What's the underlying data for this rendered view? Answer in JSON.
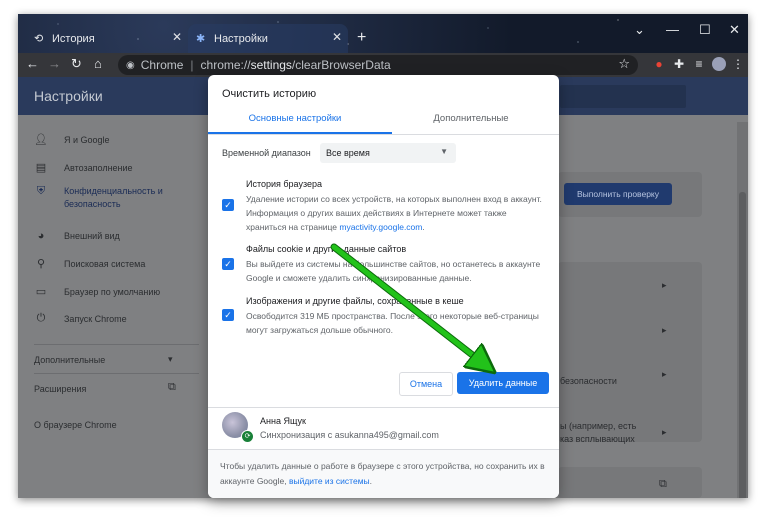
{
  "browser": {
    "tabs": [
      {
        "label": "История"
      },
      {
        "label": "Настройки"
      }
    ],
    "address": {
      "site": "Chrome",
      "url_scheme": "chrome://",
      "url_path": "settings",
      "url_rest": "/clearBrowserData"
    }
  },
  "settings": {
    "title": "Настройки",
    "sidebar": [
      {
        "label": "Я и Google"
      },
      {
        "label": "Автозаполнение"
      },
      {
        "label": "Конфиденциальность и безопасность"
      },
      {
        "label": "Внешний вид"
      },
      {
        "label": "Поисковая система"
      },
      {
        "label": "Браузер по умолчанию"
      },
      {
        "label": "Запуск Chrome"
      }
    ],
    "advanced": "Дополнительные",
    "extensions": "Расширения",
    "about": "О браузере Chrome",
    "check_button": "Выполнить проверку",
    "row_text_1": "безопасности",
    "row_text_2a": "ы (например, есть",
    "row_text_2b": "каз всплывающих"
  },
  "dialog": {
    "title": "Очистить историю",
    "tabs": {
      "basic": "Основные настройки",
      "advanced": "Дополнительные"
    },
    "time_range_label": "Временной диапазон",
    "time_range_value": "Все время",
    "items": [
      {
        "title": "История браузера",
        "desc": "Удаление истории со всех устройств, на которых выполнен вход в аккаунт. Информация о других ваших действиях в Интернете может также храниться на странице ",
        "link": "myactivity.google.com",
        "desc_end": ".",
        "checked": true
      },
      {
        "title": "Файлы cookie и другие данные сайтов",
        "desc": "Вы выйдете из системы на большинстве сайтов, но останетесь в аккаунте Google и сможете удалить синхронизированные данные.",
        "checked": true
      },
      {
        "title": "Изображения и другие файлы, сохраненные в кеше",
        "desc": "Освободится 319 МБ пространства. После этого некоторые веб-страницы могут загружаться дольше обычного.",
        "checked": true
      }
    ],
    "cancel_label": "Отмена",
    "delete_label": "Удалить данные",
    "account": {
      "name": "Анна Ящук",
      "sync": "Синхронизация с asukanna495@gmail.com"
    },
    "footer_text": "Чтобы удалить данные о работе в браузере с этого устройства, но сохранить их в аккаунте Google, ",
    "footer_link": "выйдите из системы",
    "footer_end": "."
  },
  "colors": {
    "accent": "#1a73e8",
    "arrow": "#22c21a"
  }
}
